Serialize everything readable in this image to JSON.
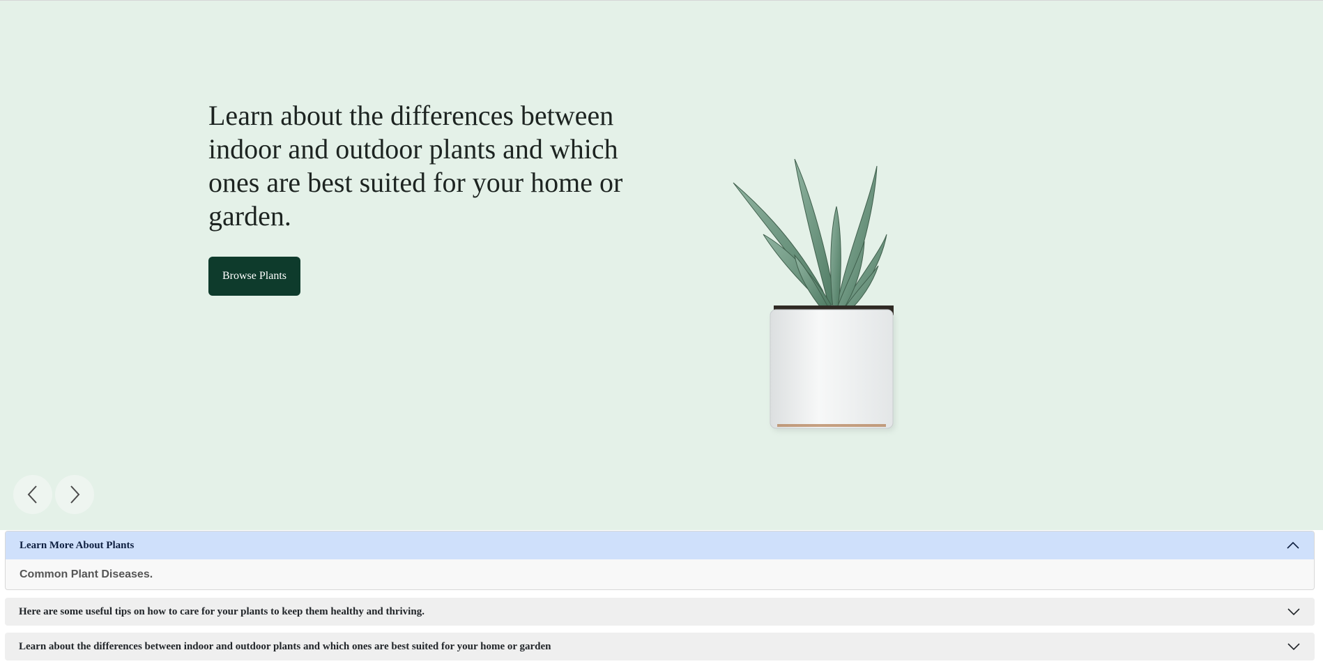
{
  "hero": {
    "headline": "Learn about the differences between indoor and outdoor plants and which ones are best suited for your home or garden.",
    "cta_label": "Browse Plants",
    "image_icon": "potted-succulent",
    "background_color": "#e4f1e8",
    "cta_color": "#0e3b2c"
  },
  "carousel": {
    "prev_icon": "chevron-left-icon",
    "next_icon": "chevron-right-icon"
  },
  "accordion": {
    "items": [
      {
        "title": "Learn More About Plants",
        "expanded": true,
        "body": "Common Plant Diseases."
      },
      {
        "title": "Here are some useful tips on how to care for your plants to keep them healthy and thriving.",
        "expanded": false
      },
      {
        "title": "Learn about the differences between indoor and outdoor plants and which ones are best suited for your home or garden",
        "expanded": false
      }
    ],
    "active_header_color": "#cfe0fb"
  }
}
